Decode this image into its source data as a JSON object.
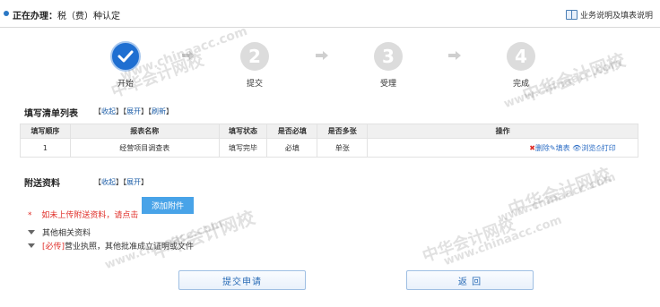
{
  "header": {
    "label": "正在办理：",
    "current_task": "税（费）种认定",
    "help_link": "业务说明及填表说明"
  },
  "steps": [
    {
      "number": "✔",
      "label": "开始",
      "active": true
    },
    {
      "number": "2",
      "label": "提交",
      "active": false
    },
    {
      "number": "3",
      "label": "受理",
      "active": false
    },
    {
      "number": "4",
      "label": "完成",
      "active": false
    }
  ],
  "list_section": {
    "title": "填写清单列表",
    "collapse": "收起",
    "expand": "展开",
    "refresh": "刷新",
    "columns": [
      "填写顺序",
      "报表名称",
      "填写状态",
      "是否必填",
      "是否多张",
      "操作"
    ],
    "rows": [
      {
        "order": "1",
        "name": "经营项目调查表",
        "status": "填写完毕",
        "required": "必填",
        "multiple": "单张",
        "actions": {
          "delete": "删除",
          "fill": "填表",
          "view": "浏览",
          "print": "打印"
        }
      }
    ]
  },
  "attach_section": {
    "title": "附送资料",
    "collapse": "收起",
    "expand": "展开",
    "notice": "如未上传附送资料，请点击",
    "add_button": "添加附件",
    "items": [
      {
        "text": "其他相关资料",
        "required_tag": ""
      },
      {
        "text": "营业执照，其他批准成立证明或文件",
        "required_tag": "[必传]"
      }
    ]
  },
  "buttons": {
    "submit": "提交申请",
    "back": "返 回"
  },
  "watermarks": {
    "cn": "中华会计网校",
    "en": "www.chinaacc.com"
  },
  "colors": {
    "accent": "#1f6fd1",
    "link": "#1f5fa8",
    "danger": "#e0302a",
    "button_fill": "#48a3e8"
  }
}
